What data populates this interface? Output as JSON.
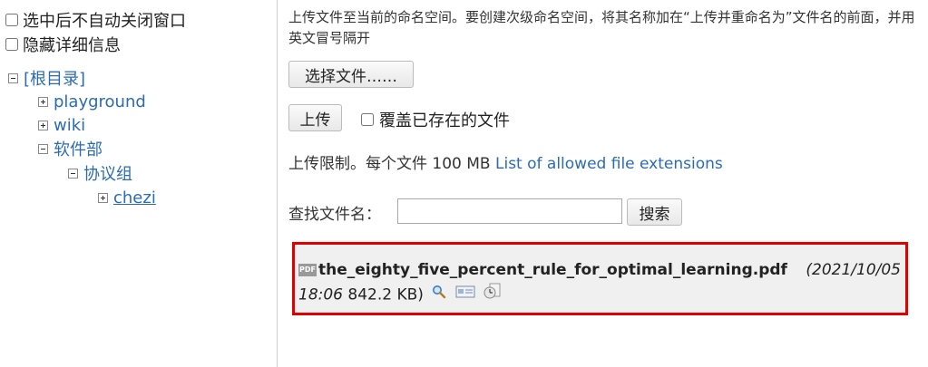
{
  "options": {
    "keep_window": "选中后不自动关闭窗口",
    "hide_details": "隐藏详细信息"
  },
  "tree": {
    "root": "[根目录]",
    "items": [
      {
        "label": "playground",
        "state": "collapsed"
      },
      {
        "label": "wiki",
        "state": "collapsed"
      },
      {
        "label": "软件部",
        "state": "expanded"
      },
      {
        "label": "协议组",
        "state": "expanded"
      },
      {
        "label": "chezi",
        "state": "collapsed"
      }
    ]
  },
  "upload": {
    "description": "上传文件至当前的命名空间。要创建次级命名空间，将其名称加在“上传并重命名为”文件名的前面，并用英文冒号隔开",
    "choose_button": "选择文件……",
    "upload_button": "上传",
    "overwrite_label": "覆盖已存在的文件",
    "limit_text": "上传限制。每个文件 100 MB",
    "limit_link": "List of allowed file extensions"
  },
  "search": {
    "label": "查找文件名：",
    "value": "",
    "button": "搜索"
  },
  "result": {
    "pdf_badge": "PDF",
    "filename": "the_eighty_five_percent_rule_for_optimal_learning.pdf",
    "date": "2021/10/05 18:06",
    "size": "842.2 KB"
  }
}
